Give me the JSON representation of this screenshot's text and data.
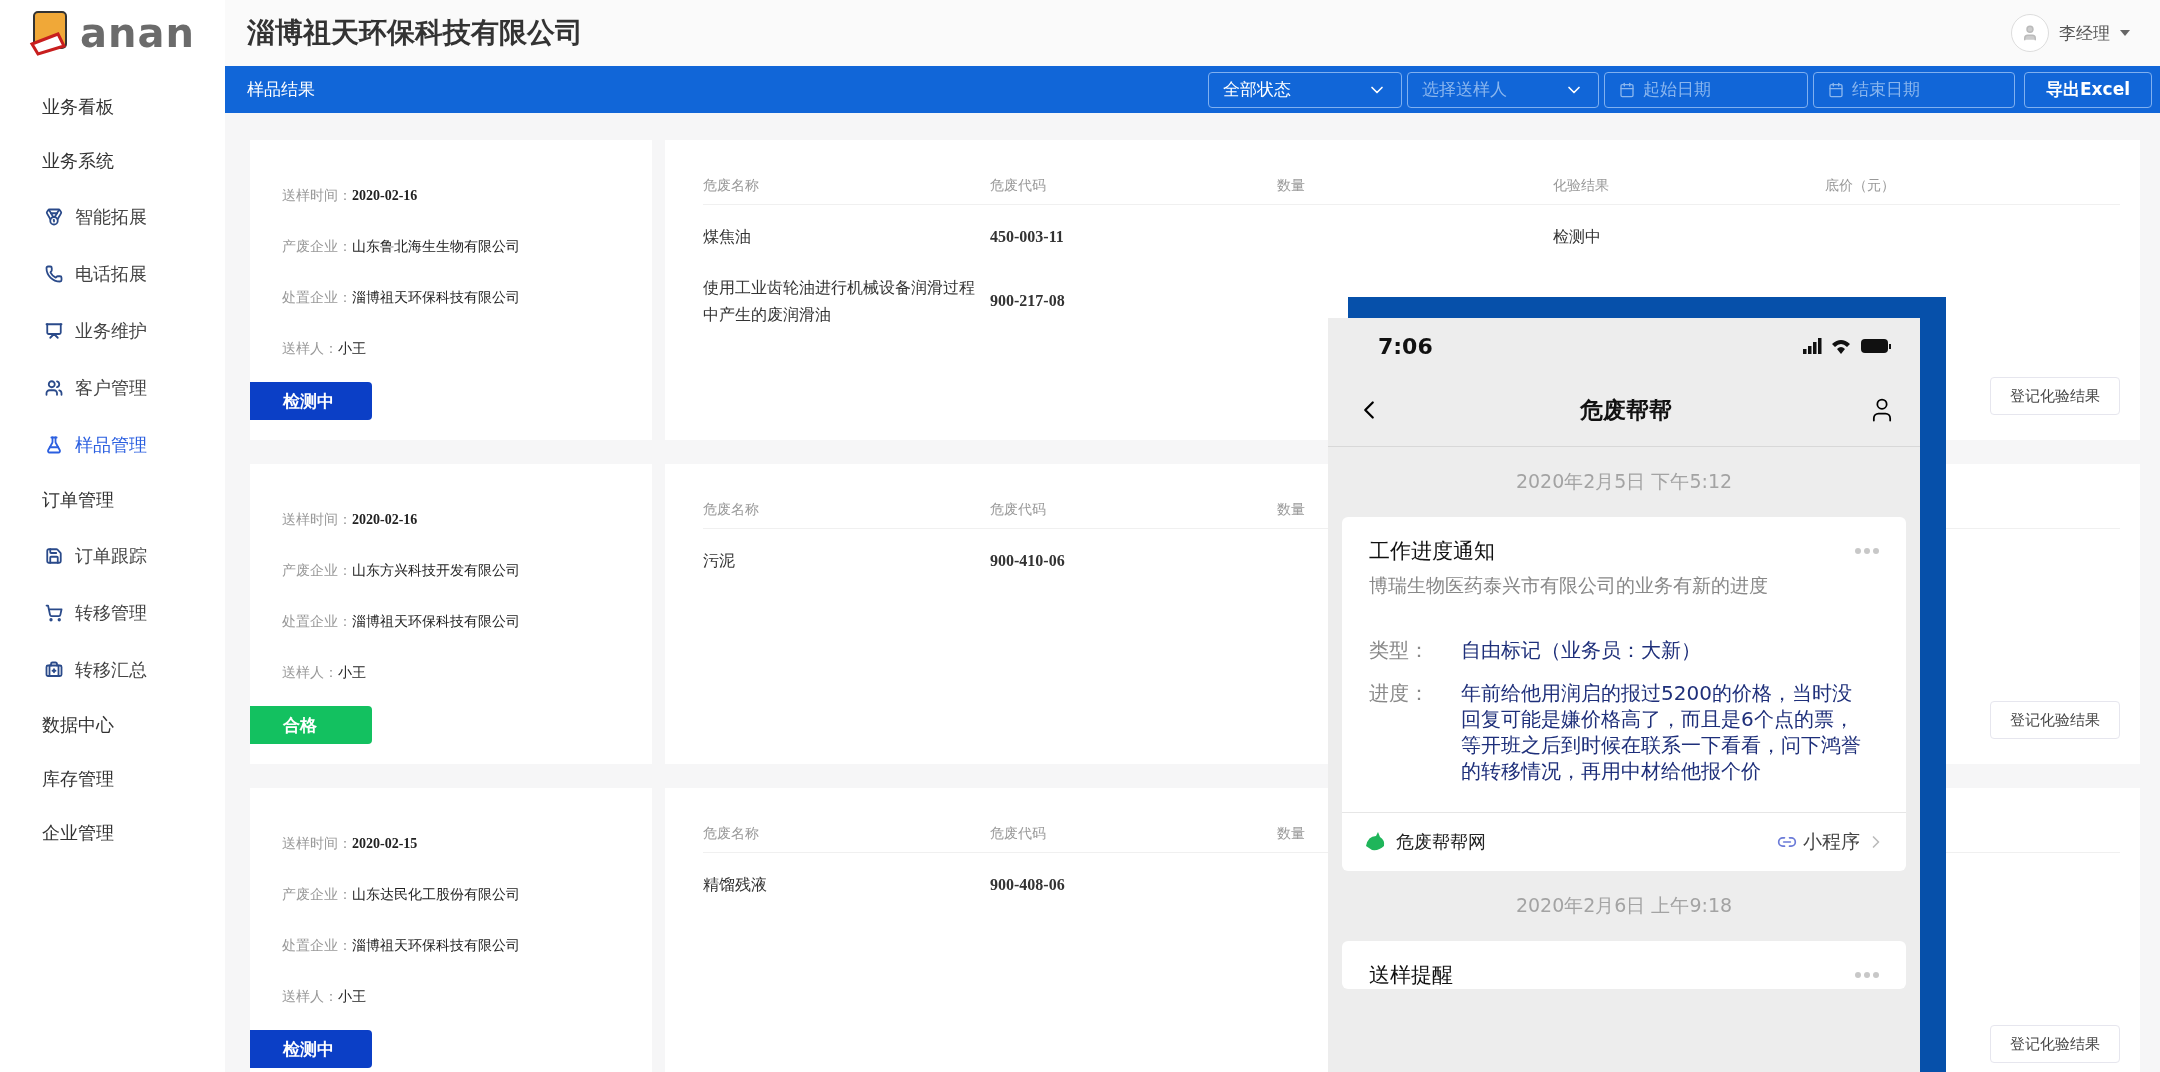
{
  "logo": {
    "text": "anan"
  },
  "header": {
    "title": "淄博祖天环保科技有限公司",
    "user": "李经理"
  },
  "sidebar": {
    "items": [
      {
        "label": "业务看板",
        "selected": false
      },
      {
        "label": "业务系统",
        "selected": false,
        "children": [
          {
            "label": "智能拓展",
            "selected": false
          },
          {
            "label": "电话拓展",
            "selected": false
          },
          {
            "label": "业务维护",
            "selected": false
          },
          {
            "label": "客户管理",
            "selected": false
          },
          {
            "label": "样品管理",
            "selected": true
          }
        ]
      },
      {
        "label": "订单管理",
        "selected": false,
        "children": [
          {
            "label": "订单跟踪",
            "selected": false
          },
          {
            "label": "转移管理",
            "selected": false
          },
          {
            "label": "转移汇总",
            "selected": false
          }
        ]
      },
      {
        "label": "数据中心",
        "selected": false
      },
      {
        "label": "库存管理",
        "selected": false
      },
      {
        "label": "企业管理",
        "selected": false
      }
    ]
  },
  "toolbar": {
    "title": "样品结果",
    "status_select": "全部状态",
    "sender_select": {
      "placeholder": "选择送样人"
    },
    "start_date": {
      "placeholder": "起始日期"
    },
    "end_date": {
      "placeholder": "结束日期"
    },
    "export_button": "导出Excel"
  },
  "samples": [
    {
      "fields": [
        {
          "label": "送样时间：",
          "value": "2020-02-16"
        },
        {
          "label": "产废企业：",
          "value": "山东鲁北海生生物有限公司"
        },
        {
          "label": "处置企业：",
          "value": "淄博祖天环保科技有限公司"
        },
        {
          "label": "送样人：",
          "value": "小王"
        }
      ],
      "status": {
        "label": "检测中",
        "color": "#0b3fc6"
      },
      "columns": [
        "危废名称",
        "危废代码",
        "数量",
        "化验结果",
        "底价（元）"
      ],
      "rows": [
        {
          "name": "煤焦油",
          "code": "450-003-11",
          "result": "检测中"
        },
        {
          "name": "使用工业齿轮油进行机械设备润滑过程中产生的废润滑油",
          "code": "900-217-08"
        }
      ],
      "action_button": "登记化验结果"
    },
    {
      "fields": [
        {
          "label": "送样时间：",
          "value": "2020-02-16"
        },
        {
          "label": "产废企业：",
          "value": "山东方兴科技开发有限公司"
        },
        {
          "label": "处置企业：",
          "value": "淄博祖天环保科技有限公司"
        },
        {
          "label": "送样人：",
          "value": "小王"
        }
      ],
      "status": {
        "label": "合格",
        "color": "#13c160"
      },
      "columns": [
        "危废名称",
        "危废代码",
        "数量"
      ],
      "rows": [
        {
          "name": "污泥",
          "code": "900-410-06"
        }
      ],
      "action_button": "登记化验结果"
    },
    {
      "fields": [
        {
          "label": "送样时间：",
          "value": "2020-02-15"
        },
        {
          "label": "产废企业：",
          "value": "山东达民化工股份有限公司"
        },
        {
          "label": "处置企业：",
          "value": "淄博祖天环保科技有限公司"
        },
        {
          "label": "送样人：",
          "value": "小王"
        }
      ],
      "status": {
        "label": "检测中",
        "color": "#0b3fc6"
      },
      "columns": [
        "危废名称",
        "危废代码",
        "数量"
      ],
      "rows": [
        {
          "name": "精馏残液",
          "code": "900-408-06"
        }
      ],
      "action_button": "登记化验结果"
    }
  ],
  "phone": {
    "time": "7:06",
    "title": "危废帮帮",
    "messages": [
      {
        "timestamp": "2020年2月5日 下午5:12",
        "title": "工作进度通知",
        "subtitle": "博瑞生物医药泰兴市有限公司的业务有新的进度",
        "fields": [
          {
            "label": "类型：",
            "value": "自由标记（业务员：大新）"
          },
          {
            "label": "进度：",
            "value": "年前给他用润启的报过5200的价格，当时没回复可能是嫌价格高了，而且是6个点的票，等开班之后到时候在联系一下看看，问下鸿誉的转移情况，再用中材给他报个价"
          }
        ],
        "footer": {
          "source": "危废帮帮网",
          "link": "小程序"
        }
      },
      {
        "timestamp": "2020年2月6日 上午9:18",
        "title": "送样提醒"
      }
    ]
  }
}
